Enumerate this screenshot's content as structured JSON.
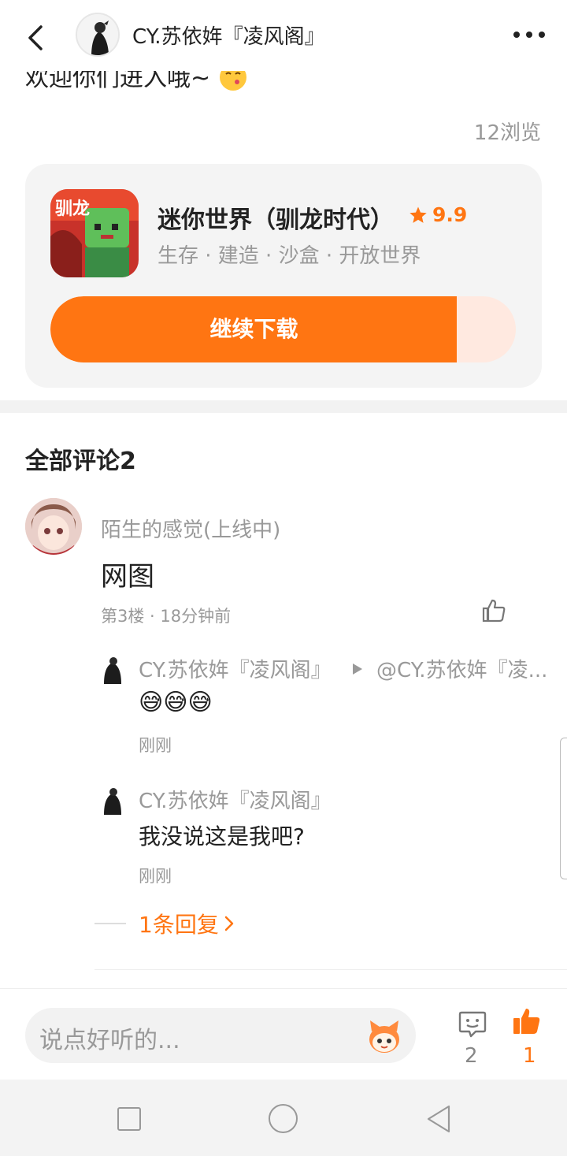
{
  "header": {
    "title": "CY.苏依姩『凌风阁』"
  },
  "post": {
    "tail_text": "欢迎你们进入哦~",
    "views": "12浏览"
  },
  "game": {
    "name": "迷你世界（驯龙时代）",
    "rating": "9.9",
    "tags": "生存 · 建造 · 沙盒 · 开放世界",
    "download_label": "继续下载",
    "download_progress": 0.873,
    "icon_text": "驯龙"
  },
  "comments": {
    "title": "全部评论2",
    "items": [
      {
        "author": "陌生的感觉(上线中)",
        "text": "网图",
        "meta": "第3楼 · 18分钟前",
        "replies": [
          {
            "author": "CY.苏依姩『凌风阁』",
            "target": "@CY.苏依姩『凌...",
            "text": "😅😅😅",
            "time": "刚刚"
          },
          {
            "author": "CY.苏依姩『凌风阁』",
            "text": "我没说这是我吧?",
            "time": "刚刚"
          }
        ],
        "more_replies": "1条回复"
      }
    ]
  },
  "bottom_bar": {
    "placeholder": "说点好听的...",
    "comment_count": "2",
    "like_count": "1"
  },
  "colors": {
    "accent": "#ff7512",
    "muted": "#999999"
  }
}
